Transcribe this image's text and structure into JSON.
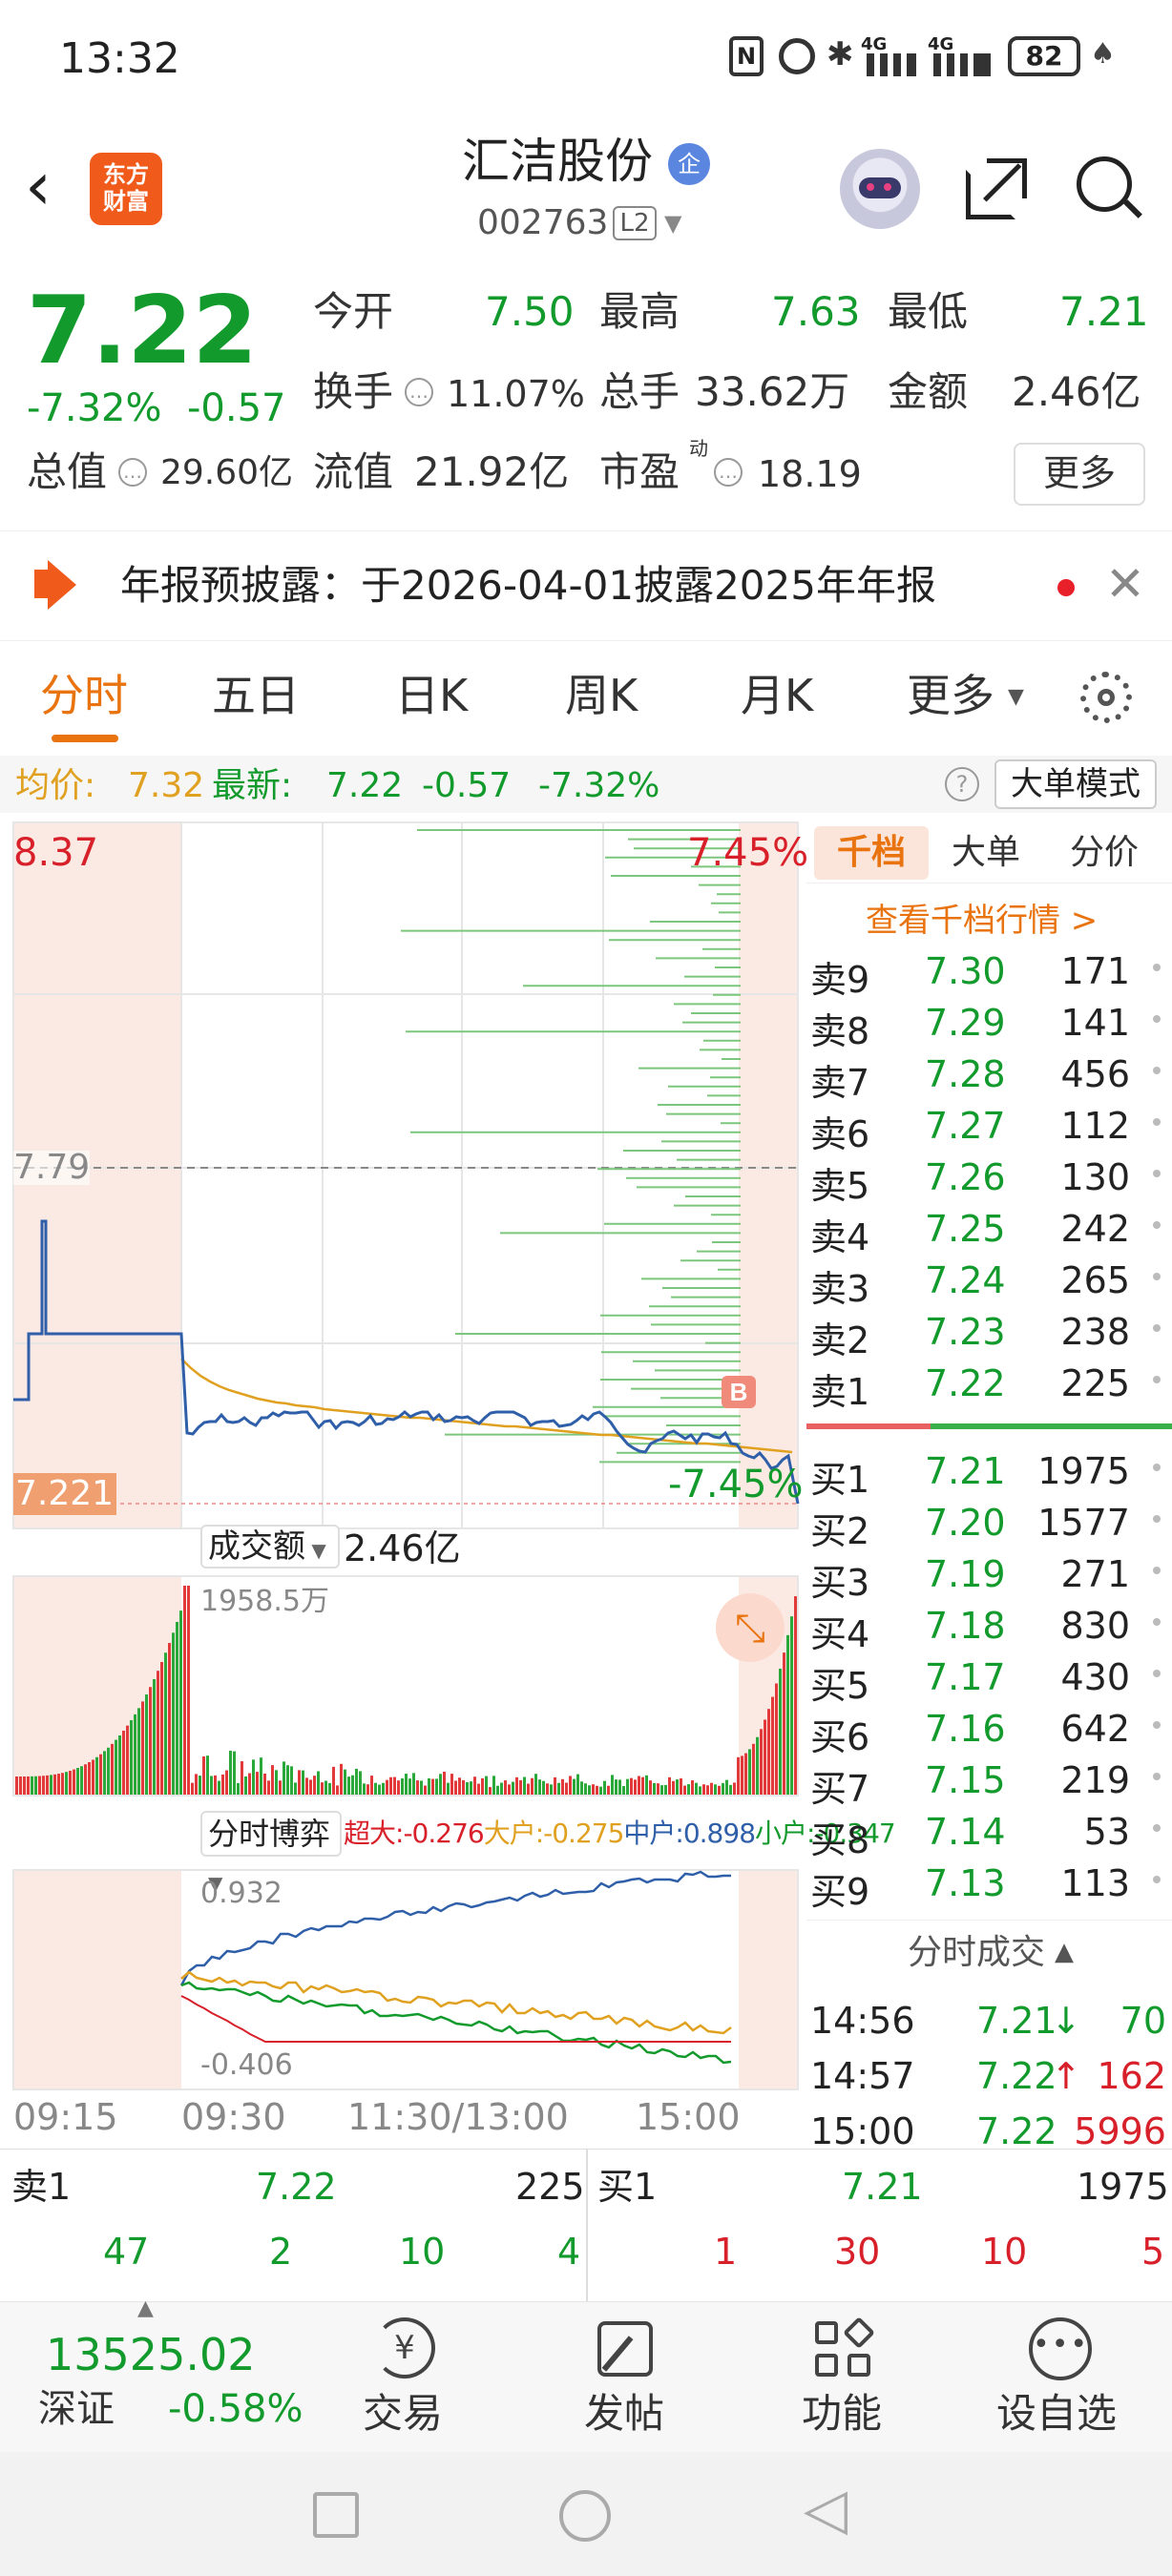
{
  "status_bar": {
    "time": "13:32",
    "battery": "82",
    "signal_labels": [
      "4G",
      "4G"
    ]
  },
  "header": {
    "back_icon": "chevron-left-icon",
    "logo_lines": [
      "东方",
      "财富"
    ],
    "stock_name": "汇洁股份",
    "enterprise_badge": "企",
    "stock_code": "002763",
    "level_badge": "L2",
    "actions": [
      "robot-avatar-icon",
      "share-icon",
      "search-icon"
    ]
  },
  "quote": {
    "price": "7.22",
    "change_pct": "-7.32%",
    "change_amt": "-0.57",
    "open_label": "今开",
    "open": "7.50",
    "high_label": "最高",
    "high": "7.63",
    "low_label": "最低",
    "low": "7.21",
    "turnover_label": "换手",
    "turnover": "11.07%",
    "volume_label": "总手",
    "volume": "33.62万",
    "amount_label": "金额",
    "amount": "2.46亿",
    "mktcap_label": "总值",
    "mktcap": "29.60亿",
    "float_label": "流值",
    "float": "21.92亿",
    "pe_label": "市盈",
    "pe_sup": "动",
    "pe": "18.19",
    "more_button": "更多"
  },
  "notice": {
    "text": "年报预披露：于2026-04-01披露2025年年报"
  },
  "tabs": {
    "items": [
      "分时",
      "五日",
      "日K",
      "周K",
      "月K",
      "更多"
    ],
    "active": 0
  },
  "infoline": {
    "avg_label": "均价:",
    "avg": "7.32",
    "latest_label": "最新:",
    "latest": "7.22",
    "chg": "-0.57",
    "pct": "-7.32%",
    "big_order_mode": "大单模式"
  },
  "chart": {
    "price_top": "8.37",
    "pct_top": "7.45%",
    "prev_close": "7.79",
    "price_bottom": "7.221",
    "pct_bottom": "-7.45%",
    "marker": "B",
    "vol_selector": "成交额",
    "vol_total": "2.46亿",
    "vol_max": "1958.5万",
    "flow_selector": "分时博弈",
    "flow_legend": [
      {
        "label": "超大:",
        "value": "-0.276",
        "color": "#d8202a"
      },
      {
        "label": "大户:",
        "value": "-0.275",
        "color": "#e0a020"
      },
      {
        "label": "中户:",
        "value": "0.898",
        "color": "#2f5fa8"
      },
      {
        "label": "小户:",
        "value": "-0.347",
        "color": "#129a2c"
      }
    ],
    "flow_max": "0.932",
    "flow_min": "-0.406",
    "time_axis": [
      "09:15",
      "09:30",
      "11:30/13:00",
      "15:00"
    ]
  },
  "orderbook": {
    "tabs": [
      "千档",
      "大单",
      "分价"
    ],
    "active_tab": 0,
    "link": "查看千档行情 >",
    "asks": [
      {
        "label": "卖9",
        "price": "7.30",
        "vol": "171"
      },
      {
        "label": "卖8",
        "price": "7.29",
        "vol": "141"
      },
      {
        "label": "卖7",
        "price": "7.28",
        "vol": "456"
      },
      {
        "label": "卖6",
        "price": "7.27",
        "vol": "112"
      },
      {
        "label": "卖5",
        "price": "7.26",
        "vol": "130"
      },
      {
        "label": "卖4",
        "price": "7.25",
        "vol": "242"
      },
      {
        "label": "卖3",
        "price": "7.24",
        "vol": "265"
      },
      {
        "label": "卖2",
        "price": "7.23",
        "vol": "238"
      },
      {
        "label": "卖1",
        "price": "7.22",
        "vol": "225"
      }
    ],
    "bids": [
      {
        "label": "买1",
        "price": "7.21",
        "vol": "1975"
      },
      {
        "label": "买2",
        "price": "7.20",
        "vol": "1577"
      },
      {
        "label": "买3",
        "price": "7.19",
        "vol": "271"
      },
      {
        "label": "买4",
        "price": "7.18",
        "vol": "830"
      },
      {
        "label": "买5",
        "price": "7.17",
        "vol": "430"
      },
      {
        "label": "买6",
        "price": "7.16",
        "vol": "642"
      },
      {
        "label": "买7",
        "price": "7.15",
        "vol": "219"
      },
      {
        "label": "买8",
        "price": "7.14",
        "vol": "53"
      },
      {
        "label": "买9",
        "price": "7.13",
        "vol": "113"
      }
    ],
    "ticks_title": "分时成交",
    "ticks": [
      {
        "time": "14:56",
        "price": "7.21",
        "arrow": "↓",
        "vol": "70"
      },
      {
        "time": "14:57",
        "price": "7.22",
        "arrow": "↑",
        "vol": "162"
      },
      {
        "time": "15:00",
        "price": "7.22",
        "arrow": "",
        "vol": "5996"
      }
    ]
  },
  "bottom_row": {
    "sell1_label": "卖1",
    "sell1_price": "7.22",
    "sell1_vol": "225",
    "buy1_label": "买1",
    "buy1_price": "7.21",
    "buy1_vol": "1975",
    "sell_queue": [
      "47",
      "2",
      "10",
      "4"
    ],
    "buy_queue": [
      "1",
      "30",
      "10",
      "5"
    ]
  },
  "bottom_nav": {
    "index_value": "13525.02",
    "index_name": "深证",
    "index_pct": "-0.58%",
    "items": [
      {
        "label": "交易",
        "icon": "yen-trade-icon"
      },
      {
        "label": "发帖",
        "icon": "edit-post-icon"
      },
      {
        "label": "功能",
        "icon": "grid-apps-icon"
      },
      {
        "label": "设自选",
        "icon": "more-circle-icon"
      }
    ]
  },
  "colors": {
    "up": "#d8202a",
    "down": "#129a2c",
    "accent": "#e8730f",
    "price_line": "#2f5fa8",
    "avg_line": "#e0a020"
  }
}
